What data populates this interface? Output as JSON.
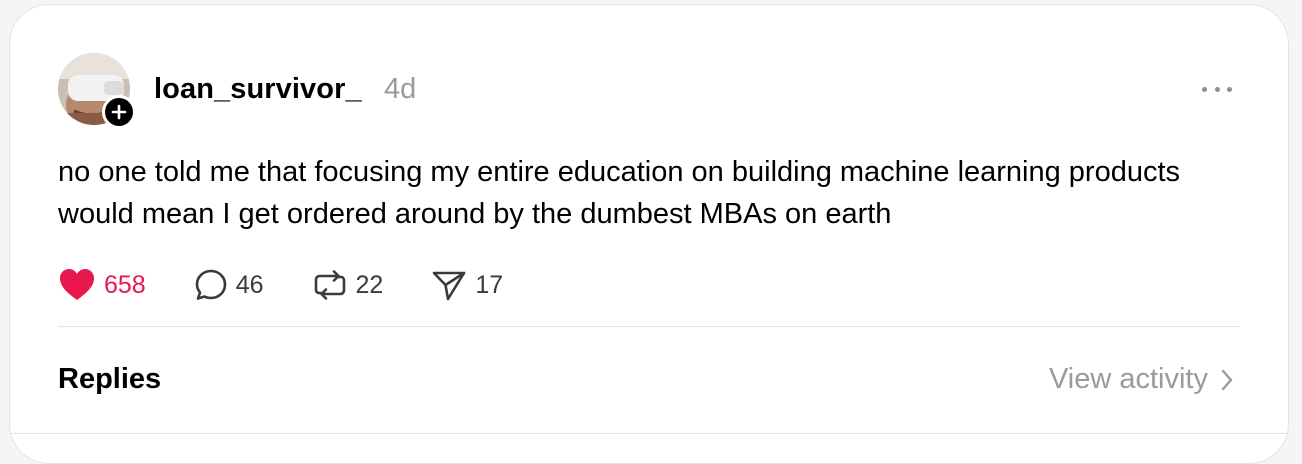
{
  "post": {
    "username": "loan_survivor_",
    "time": "4d",
    "text": "no one told me that focusing my entire education on building machine learning products would mean I get ordered around by the dumbest MBAs on earth",
    "avatar_icon": "avatar-photo",
    "follow_icon": "plus-icon",
    "more_icon": "more-icon"
  },
  "actions": {
    "like_count": "658",
    "comment_count": "46",
    "repost_count": "22",
    "share_count": "17",
    "like_color": "#e8174d"
  },
  "footer": {
    "replies_label": "Replies",
    "view_activity_label": "View activity"
  }
}
